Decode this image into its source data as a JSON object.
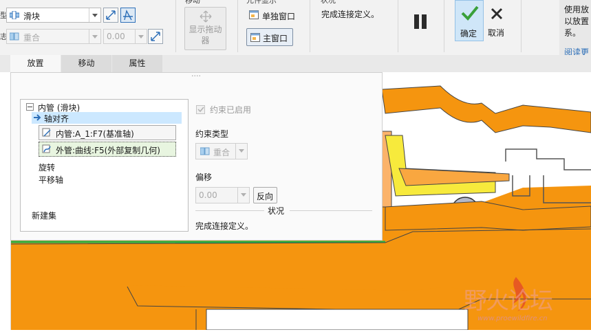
{
  "ribbon": {
    "row1_label_cut": "型:",
    "row2_label_cut": "志:",
    "connection_type": "滑块",
    "constraint_combo": "重合",
    "offset_value": "0.00",
    "move_group_label_cut": "移动",
    "show_drag_label": "显示拖动器",
    "window_group_label_cut": "元件显示",
    "single_window_label": "单独窗口",
    "main_window_label": "主窗口",
    "status_group_label_cut": "状况",
    "status_text": "完成连接定义。",
    "ok_label": "确定",
    "cancel_label": "取消",
    "help_text_lines": [
      "使用放",
      "以放置",
      "系。"
    ],
    "help_link": "阅读更"
  },
  "tabs": [
    "放置",
    "移动",
    "属性"
  ],
  "panel": {
    "grip": "····",
    "tree": {
      "root": "内管 (滑块)",
      "set": "轴对齐",
      "ref1": "内管:A_1:F7(基准轴)",
      "ref2": "外管:曲线:F5(外部复制几何)",
      "rotate": "旋转",
      "translate": "平移轴",
      "new_set": "新建集"
    },
    "constraint_enabled": "约束已启用",
    "constraint_type_label": "约束类型",
    "constraint_type_value": "重合",
    "offset_label": "偏移",
    "offset_value": "0.00",
    "flip_label": "反向",
    "status_section": "状况",
    "status_text": "完成连接定义。"
  },
  "watermark": {
    "logo_text": "野火论坛",
    "url": "www.proewildfire.cn"
  },
  "colors": {
    "accent_blue": "#2d6fb8",
    "selection_blue": "#cce8ff",
    "ok_green": "#3aa03a",
    "model_orange": "#f5950f",
    "model_orange_light": "#fbb36a",
    "model_yellow": "#f7ea3c",
    "watermark_red": "#e2462a"
  },
  "icons": [
    "dropdown-arrow-icon",
    "flip-direction-icon",
    "axis-icon",
    "constraint-coincident-icon",
    "move-arrows-icon",
    "window-icon",
    "pause-icon",
    "check-icon",
    "close-icon",
    "tree-collapse-icon",
    "arrow-right-icon",
    "datum-axis-icon",
    "curve-icon"
  ]
}
